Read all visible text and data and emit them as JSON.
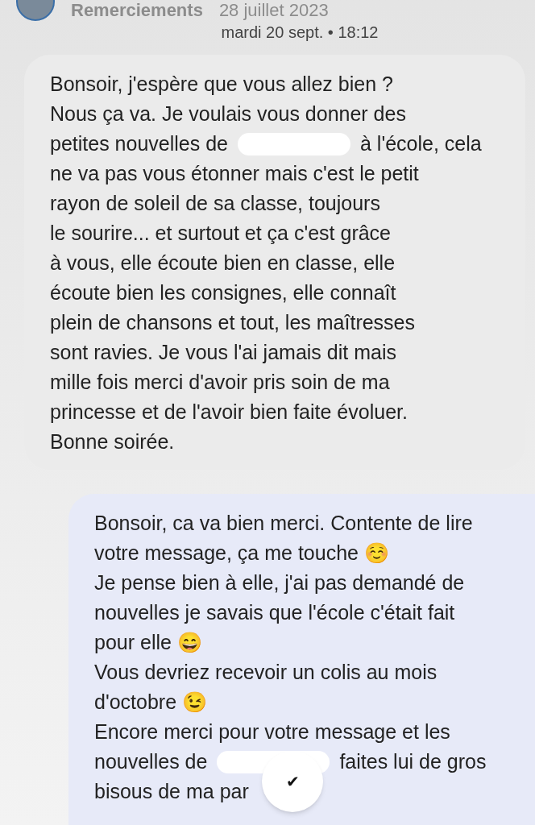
{
  "story_header": {
    "title": "Remerciements",
    "date": "28 juillet 2023"
  },
  "timestamp": "mardi 20 sept. • 18:12",
  "messages": [
    {
      "kind": "received",
      "lines": [
        [
          {
            "kind": "text",
            "text": "Bonsoir, j'espère que vous allez bien ?"
          }
        ],
        [
          {
            "kind": "text",
            "text": "Nous ça va. Je voulais vous donner des"
          }
        ],
        [
          {
            "kind": "text",
            "text": "petites nouvelles de"
          },
          {
            "kind": "redaction"
          },
          {
            "kind": "text",
            "text": "à l'école, cela"
          }
        ],
        [
          {
            "kind": "text",
            "text": "ne va pas vous étonner mais c'est le petit"
          }
        ],
        [
          {
            "kind": "text",
            "text": "rayon de soleil de sa classe, toujours"
          }
        ],
        [
          {
            "kind": "text",
            "text": "le sourire... et surtout et ça c'est grâce"
          }
        ],
        [
          {
            "kind": "text",
            "text": "à vous, elle écoute bien en classe, elle"
          }
        ],
        [
          {
            "kind": "text",
            "text": "écoute bien les consignes, elle connaît"
          }
        ],
        [
          {
            "kind": "text",
            "text": "plein de chansons et tout, les maîtresses"
          }
        ],
        [
          {
            "kind": "text",
            "text": "sont ravies. Je vous l'ai jamais dit mais"
          }
        ],
        [
          {
            "kind": "text",
            "text": "mille fois merci d'avoir pris soin de ma"
          }
        ],
        [
          {
            "kind": "text",
            "text": "princesse et de l'avoir bien faite évoluer."
          }
        ],
        [
          {
            "kind": "text",
            "text": "Bonne soirée."
          }
        ]
      ]
    },
    {
      "kind": "sent",
      "lines": [
        [
          {
            "kind": "text",
            "text": "Bonsoir, ca va bien merci. Contente de lire"
          }
        ],
        [
          {
            "kind": "text",
            "text": "votre message, ça me touche ☺️"
          }
        ],
        [
          {
            "kind": "text",
            "text": "Je pense bien à elle, j'ai pas demandé de"
          }
        ],
        [
          {
            "kind": "text",
            "text": "nouvelles je savais que l'école c'était fait"
          }
        ],
        [
          {
            "kind": "text",
            "text": "pour elle 😄"
          }
        ],
        [
          {
            "kind": "text",
            "text": "Vous devriez recevoir un colis au mois"
          }
        ],
        [
          {
            "kind": "text",
            "text": "d'octobre 😉"
          }
        ],
        [
          {
            "kind": "text",
            "text": "Encore merci pour votre message et les"
          }
        ],
        [
          {
            "kind": "text",
            "text": "nouvelles de"
          },
          {
            "kind": "redaction"
          },
          {
            "kind": "text",
            "text": "faites lui de gros"
          }
        ],
        [
          {
            "kind": "text",
            "text": "bisous de ma par"
          }
        ]
      ]
    }
  ],
  "check_button": {
    "symbol": "✔"
  }
}
